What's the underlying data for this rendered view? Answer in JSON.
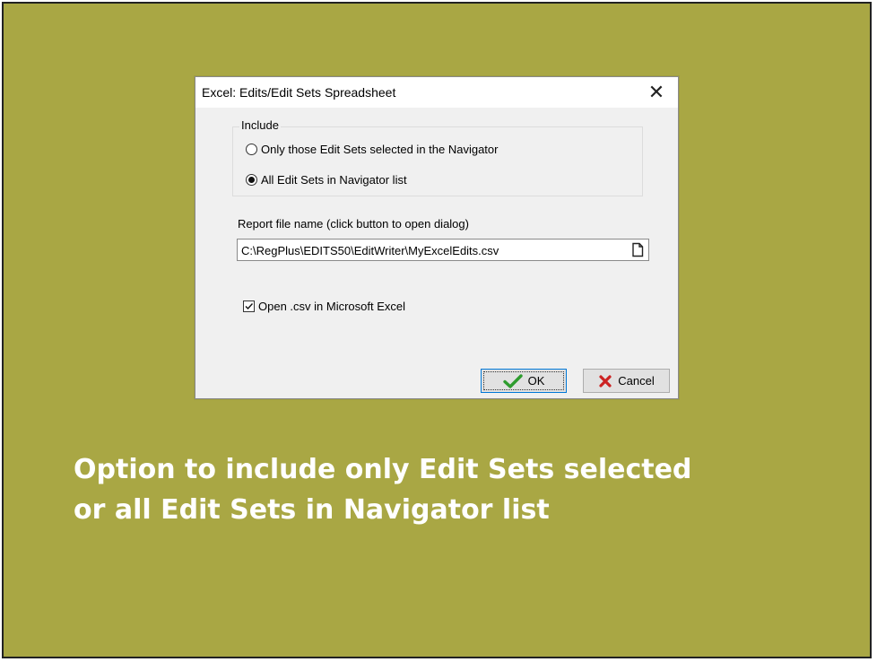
{
  "dialog": {
    "title": "Excel: Edits/Edit Sets Spreadsheet",
    "include_group": {
      "label": "Include",
      "options": [
        {
          "label": "Only those Edit Sets selected in the Navigator",
          "selected": false
        },
        {
          "label": "All Edit Sets in Navigator list",
          "selected": true
        }
      ]
    },
    "report_file": {
      "label": "Report file name (click button to open dialog)",
      "value": "C:\\RegPlus\\EDITS50\\EditWriter\\MyExcelEdits.csv",
      "button_icon": "file-icon"
    },
    "open_excel": {
      "label": "Open .csv in Microsoft Excel",
      "checked": true
    },
    "buttons": {
      "ok": "OK",
      "cancel": "Cancel"
    },
    "close_icon": "close-icon"
  },
  "caption": {
    "line1": "Option to include only Edit Sets selected",
    "line2": "or all Edit Sets in Navigator list"
  },
  "colors": {
    "slide_background": "#a9a744",
    "caption_text": "#ffffff",
    "ok_check": "#2e9c2e",
    "cancel_x": "#cc2222"
  }
}
